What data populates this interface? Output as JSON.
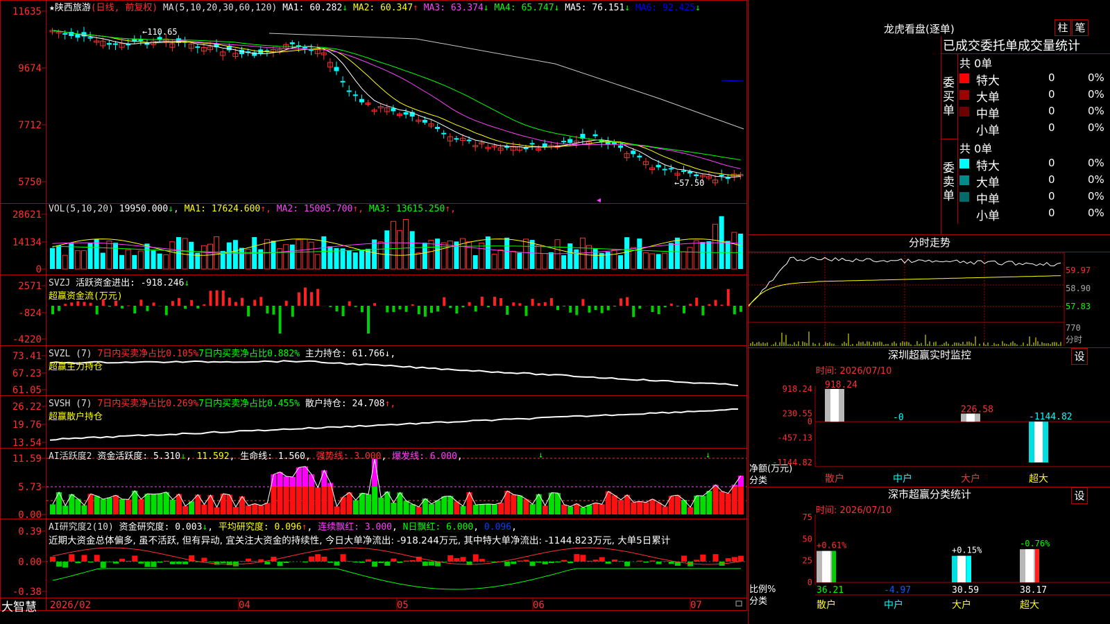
{
  "app": {
    "name": "大智慧"
  },
  "top_panel": {
    "star": "★",
    "stock_name": "陕西旅游",
    "stock_mode": "(日线, 前复权)",
    "ma_header": "MA(5,10,20,30,60,120)",
    "ma_values": [
      {
        "label": "MA1:",
        "value": "60.282",
        "arrow": "↓",
        "color": "#ffffff"
      },
      {
        "label": "MA2:",
        "value": "60.347",
        "arrow": "↑",
        "color": "#ffff00"
      },
      {
        "label": "MA3:",
        "value": "63.374",
        "arrow": "↓",
        "color": "#ff40ff"
      },
      {
        "label": "MA4:",
        "value": "65.747",
        "arrow": "↓",
        "color": "#00ff00"
      },
      {
        "label": "MA5:",
        "value": "76.151",
        "arrow": "↓",
        "color": "#ffffff"
      },
      {
        "label": "MA6:",
        "value": "92.425",
        "arrow": "↓",
        "color": "#0000ff"
      }
    ],
    "y_labels": [
      "11635",
      "9674",
      "7712",
      "5750"
    ],
    "high_marker": "←110.65",
    "low_marker": "←57.50"
  },
  "vol_panel": {
    "header": "VOL(5,10,20)",
    "value": "19950.000",
    "value_arrow": "↓",
    "ma_values": [
      {
        "label": "MA1:",
        "value": "17624.600",
        "arrow": "↑",
        "color": "#ffff00"
      },
      {
        "label": "MA2:",
        "value": "15005.700",
        "arrow": "↑",
        "color": "#ff40ff"
      },
      {
        "label": "MA3:",
        "value": "13615.250",
        "arrow": "↑",
        "color": "#00ff00"
      }
    ],
    "y_labels": [
      "28621",
      "14134",
      "0"
    ]
  },
  "svzj_panel": {
    "header": "SVZJ",
    "field": "活跃资金进出:",
    "value": "-918.246",
    "arrow": "↓",
    "subtitle": "超赢资金流(万元)",
    "y_labels": [
      "2571",
      "-824",
      "-4220"
    ]
  },
  "svzl_panel": {
    "header": "SVZL (7)",
    "field1": "7日内买卖净占比0.105%",
    "field2": "7日内买卖净占比0.882%",
    "field3": "主力持仓: 61.766",
    "arrow": "↓,",
    "subtitle": "超赢主力持仓",
    "y_labels": [
      "73.41",
      "67.23",
      "61.05"
    ]
  },
  "svsh_panel": {
    "header": "SVSH (7)",
    "field1": "7日内买卖净占比0.269%",
    "field2": "7日内买卖净占比0.455%",
    "field3": "散户持仓: 24.708",
    "arrow": "↑,",
    "subtitle": "超赢散户持仓",
    "y_labels": [
      "26.22",
      "19.76",
      "13.54"
    ]
  },
  "ai_active_panel": {
    "header": "AI活跃度2",
    "field1": "资金活跃度: 5.310",
    "arrow1": "↓",
    "field2": "11.592",
    "field3": "生命线: 1.560",
    "field4": "强势线: 3.000",
    "field5": "爆发线: 6.000",
    "y_labels": [
      "11.59",
      "5.73",
      "0.00"
    ]
  },
  "ai_research_panel": {
    "header": "AI研究度2(10)",
    "field1": "资金研究度: 0.003",
    "arrow1": "↓",
    "field2": "平均研究度: 0.096",
    "arrow2": "↑",
    "field3": "连续飘红: 3.000",
    "field4": "N日飘红: 6.000",
    "field5": "0.096",
    "comment": "近期大资金总体偏多, 虽不活跃, 但有异动, 宜关注大资金的持续性, 今日大单净流出: -918.244万元, 其中特大单净流出: -1144.823万元, 大单5日累计",
    "y_labels": [
      "0.39",
      "0.00",
      "-0.38"
    ]
  },
  "date_axis": [
    "2026/02",
    "04",
    "05",
    "06",
    "07"
  ],
  "dragon_tiger": {
    "title": "龙虎看盘(逐单)",
    "btn_column": "柱",
    "btn_stroke": "笔",
    "subtitle": "已成交委托单成交量统计",
    "buy_side": "委买单",
    "sell_side": "委卖单",
    "buy_total": "共 0单",
    "sell_total": "共 0单",
    "buy_rows": [
      {
        "label": "特大",
        "count": "0",
        "pct": "0%",
        "color": "#ff0000"
      },
      {
        "label": "大单",
        "count": "0",
        "pct": "0%",
        "color": "#a00000"
      },
      {
        "label": "中单",
        "count": "0",
        "pct": "0%",
        "color": "#700000"
      },
      {
        "label": "小单",
        "count": "0",
        "pct": "0%",
        "color": ""
      }
    ],
    "sell_rows": [
      {
        "label": "特大",
        "count": "0",
        "pct": "0%",
        "color": "#00ffff"
      },
      {
        "label": "大单",
        "count": "0",
        "pct": "0%",
        "color": "#008a8a"
      },
      {
        "label": "中单",
        "count": "0",
        "pct": "0%",
        "color": "#006a6a"
      },
      {
        "label": "小单",
        "count": "0",
        "pct": "0%",
        "color": ""
      }
    ]
  },
  "intraday": {
    "title": "分时走势",
    "price_labels": [
      "59.97",
      "58.90",
      "57.83"
    ],
    "vol_label": "770",
    "vol_unit": "分时"
  },
  "sz_monitor": {
    "title": "深圳超赢实时监控",
    "btn": "设",
    "time": "时间: 2026/07/10",
    "y_labels": [
      "918.24",
      "230.55",
      "0",
      "-457.13",
      "-1144.82"
    ],
    "unit": "净额(万元)",
    "category_label": "分类",
    "value_labels": [
      "918.24",
      "-0",
      "226.58",
      "-1144.82"
    ],
    "categories": [
      "散户",
      "中户",
      "大户",
      "超大"
    ]
  },
  "sz_class": {
    "title": "深市超赢分类统计",
    "btn": "设",
    "time": "时间: 2026/07/10",
    "y_labels": [
      "75",
      "50",
      "25",
      "0"
    ],
    "unit": "比例%",
    "category_label": "分类",
    "pct_labels": [
      "+0.61%",
      "+0.15%",
      "-0.76%"
    ],
    "value_labels": [
      "36.21",
      "-4.97",
      "30.59",
      "38.17"
    ],
    "categories": [
      "散户",
      "中户",
      "大户",
      "超大"
    ]
  },
  "chart_data": [
    {
      "type": "bar",
      "title": "深圳超赢实时监控",
      "ylabel": "净额(万元)",
      "categories": [
        "散户",
        "中户",
        "大户",
        "超大"
      ],
      "values": [
        918.24,
        0,
        226.58,
        -1144.82
      ],
      "ylim": [
        -1144.82,
        918.24
      ]
    },
    {
      "type": "bar",
      "title": "深市超赢分类统计",
      "ylabel": "比例%",
      "categories": [
        "散户",
        "中户",
        "大户",
        "超大"
      ],
      "values": [
        36.21,
        -4.97,
        30.59,
        38.17
      ],
      "ylim": [
        0,
        75
      ]
    },
    {
      "type": "bar",
      "title": "VOL(5,10,20)",
      "values_last": 19950,
      "ylim": [
        0,
        28621
      ]
    }
  ]
}
